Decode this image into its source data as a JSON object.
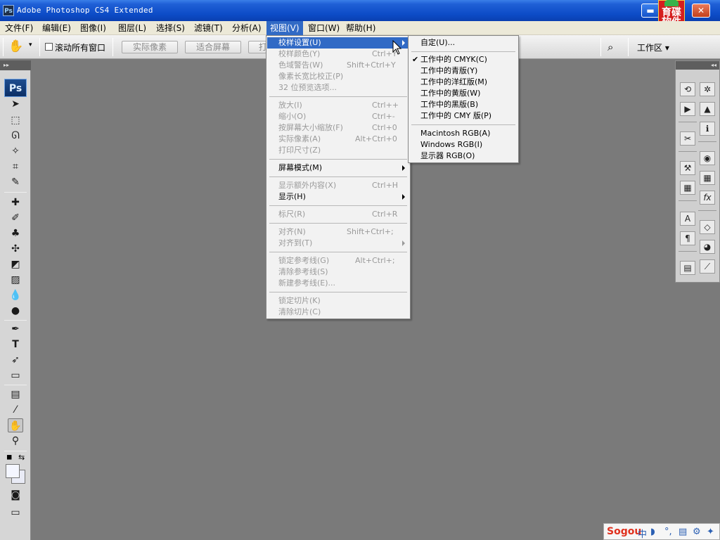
{
  "window": {
    "icon_label": "Ps",
    "title": "Adobe Photoshop CS4 Extended",
    "minimize_glyph": "▬",
    "close_glyph": "✕",
    "corner_logo_text": "育碟软件"
  },
  "menubar": [
    {
      "label": "文件(F)"
    },
    {
      "label": "编辑(E)"
    },
    {
      "label": "图像(I)"
    },
    {
      "label": "图层(L)"
    },
    {
      "label": "选择(S)"
    },
    {
      "label": "滤镜(T)"
    },
    {
      "label": "分析(A)"
    },
    {
      "label": "视图(V)"
    },
    {
      "label": "窗口(W)"
    },
    {
      "label": "帮助(H)"
    }
  ],
  "options": {
    "scroll_all_label": "滚动所有窗口",
    "actual_pixels_label": "实际像素",
    "fit_screen_label": "适合屏幕",
    "print_size_partial": "打",
    "workspace_label": "工作区 ▾"
  },
  "toolbox": {
    "header_glyph": "▸▸",
    "logo": "Ps",
    "tools": [
      {
        "icon": "move-tool-icon",
        "glyph": "➤"
      },
      {
        "icon": "marquee-tool-icon",
        "glyph": "⬚"
      },
      {
        "icon": "lasso-tool-icon",
        "glyph": "ᘏ"
      },
      {
        "icon": "magic-wand-icon",
        "glyph": "✧"
      },
      {
        "icon": "crop-tool-icon",
        "glyph": "⌗"
      },
      {
        "icon": "eyedropper-tool-icon",
        "glyph": "✎"
      },
      {
        "icon": "healing-brush-icon",
        "glyph": "✚"
      },
      {
        "icon": "brush-tool-icon",
        "glyph": "✐"
      },
      {
        "icon": "clone-stamp-icon",
        "glyph": "♣"
      },
      {
        "icon": "history-brush-icon",
        "glyph": "✣"
      },
      {
        "icon": "eraser-tool-icon",
        "glyph": "◩"
      },
      {
        "icon": "gradient-tool-icon",
        "glyph": "▨"
      },
      {
        "icon": "blur-tool-icon",
        "glyph": "💧"
      },
      {
        "icon": "dodge-tool-icon",
        "glyph": "●"
      },
      {
        "icon": "pen-tool-icon",
        "glyph": "✒"
      },
      {
        "icon": "type-tool-icon",
        "glyph": "T"
      },
      {
        "icon": "path-selection-icon",
        "glyph": "➶"
      },
      {
        "icon": "shape-tool-icon",
        "glyph": "▭"
      },
      {
        "icon": "notes-tool-icon",
        "glyph": "▤"
      },
      {
        "icon": "eyedropper-3d-icon",
        "glyph": "⁄"
      },
      {
        "icon": "hand-tool-icon",
        "glyph": "✋"
      },
      {
        "icon": "zoom-tool-icon",
        "glyph": "⚲"
      }
    ],
    "quick_mask_glyph": "◙",
    "screen_mode_glyph": "▭"
  },
  "dock": {
    "header_glyph": "◂◂",
    "left_column": [
      "history-icon",
      "actions-icon",
      "tools-presets-icon",
      "clone-source-icon",
      "layer-comps-icon",
      "character-icon",
      "paragraph-icon",
      "notes-icon"
    ],
    "left_glyphs": [
      "⟲",
      "▶",
      "✂",
      "⚒",
      "▦",
      "A",
      "¶",
      "▤"
    ],
    "right_column": [
      "navigator-icon",
      "histogram-icon",
      "info-icon",
      "color-icon",
      "swatches-icon",
      "styles-icon",
      "layers-icon",
      "channels-icon",
      "paths-icon"
    ],
    "right_glyphs": [
      "✲",
      "▲",
      "ℹ",
      "◉",
      "▦",
      "fx",
      "◇",
      "◕",
      "⟋"
    ]
  },
  "view_menu": {
    "items": [
      {
        "label": "校样设置(U)",
        "shortcut": "",
        "state": "highlighted",
        "submenu": true
      },
      {
        "label": "校样颜色(Y)",
        "shortcut": "Ctrl+Y",
        "state": "disabled",
        "submenu": false
      },
      {
        "label": "色域警告(W)",
        "shortcut": "Shift+Ctrl+Y",
        "state": "disabled",
        "submenu": false
      },
      {
        "label": "像素长宽比校正(P)",
        "shortcut": "",
        "state": "disabled",
        "submenu": false
      },
      {
        "label": "32 位预览选项...",
        "shortcut": "",
        "state": "disabled",
        "submenu": false
      },
      {
        "label": "放大(I)",
        "shortcut": "Ctrl++",
        "state": "disabled",
        "submenu": false
      },
      {
        "label": "缩小(O)",
        "shortcut": "Ctrl+-",
        "state": "disabled",
        "submenu": false
      },
      {
        "label": "按屏幕大小缩放(F)",
        "shortcut": "Ctrl+0",
        "state": "disabled",
        "submenu": false
      },
      {
        "label": "实际像素(A)",
        "shortcut": "Alt+Ctrl+0",
        "state": "disabled",
        "submenu": false
      },
      {
        "label": "打印尺寸(Z)",
        "shortcut": "",
        "state": "disabled",
        "submenu": false
      },
      {
        "label": "屏幕模式(M)",
        "shortcut": "",
        "state": "enabled",
        "submenu": true
      },
      {
        "label": "显示额外内容(X)",
        "shortcut": "Ctrl+H",
        "state": "disabled",
        "submenu": false
      },
      {
        "label": "显示(H)",
        "shortcut": "",
        "state": "enabled",
        "submenu": true
      },
      {
        "label": "标尺(R)",
        "shortcut": "Ctrl+R",
        "state": "disabled",
        "submenu": false
      },
      {
        "label": "对齐(N)",
        "shortcut": "Shift+Ctrl+;",
        "state": "disabled",
        "submenu": false
      },
      {
        "label": "对齐到(T)",
        "shortcut": "",
        "state": "disabled",
        "submenu": true
      },
      {
        "label": "锁定参考线(G)",
        "shortcut": "Alt+Ctrl+;",
        "state": "disabled",
        "submenu": false
      },
      {
        "label": "清除参考线(S)",
        "shortcut": "",
        "state": "disabled",
        "submenu": false
      },
      {
        "label": "新建参考线(E)...",
        "shortcut": "",
        "state": "disabled",
        "submenu": false
      },
      {
        "label": "锁定切片(K)",
        "shortcut": "",
        "state": "disabled",
        "submenu": false
      },
      {
        "label": "清除切片(C)",
        "shortcut": "",
        "state": "disabled",
        "submenu": false
      }
    ]
  },
  "proof_submenu": {
    "items": [
      {
        "label": "自定(U)...",
        "checked": false
      },
      {
        "label": "工作中的 CMYK(C)",
        "checked": true
      },
      {
        "label": "工作中的青版(Y)",
        "checked": false
      },
      {
        "label": "工作中的洋红版(M)",
        "checked": false
      },
      {
        "label": "工作中的黄版(W)",
        "checked": false
      },
      {
        "label": "工作中的黑版(B)",
        "checked": false
      },
      {
        "label": "工作中的 CMY 版(P)",
        "checked": false
      },
      {
        "label": "Macintosh RGB(A)",
        "checked": false
      },
      {
        "label": "Windows RGB(I)",
        "checked": false
      },
      {
        "label": "显示器 RGB(O)",
        "checked": false
      }
    ]
  },
  "ime": {
    "logo": "Sogou",
    "items": [
      "中",
      "◗",
      "°,",
      "▤",
      "⚙",
      "✦"
    ]
  },
  "colors": {
    "canvas_bg": "#7a7a7a",
    "menu_highlight": "#316ac5",
    "titlebar": "#0c4bc6"
  }
}
